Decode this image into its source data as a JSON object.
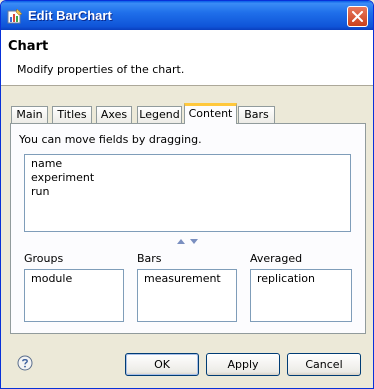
{
  "window": {
    "title": "Edit BarChart"
  },
  "header": {
    "title": "Chart",
    "description": "Modify properties of the chart."
  },
  "tabs": [
    {
      "label": "Main",
      "active": false
    },
    {
      "label": "Titles",
      "active": false
    },
    {
      "label": "Axes",
      "active": false
    },
    {
      "label": "Legend",
      "active": false
    },
    {
      "label": "Content",
      "active": true
    },
    {
      "label": "Bars",
      "active": false
    }
  ],
  "content": {
    "hint": "You can move fields by dragging.",
    "fields": [
      "name",
      "experiment",
      "run"
    ],
    "groups": {
      "label": "Groups",
      "items": [
        "module"
      ]
    },
    "bars": {
      "label": "Bars",
      "items": [
        "measurement"
      ]
    },
    "averaged": {
      "label": "Averaged",
      "items": [
        "replication"
      ]
    }
  },
  "buttons": {
    "ok": "OK",
    "apply": "Apply",
    "cancel": "Cancel"
  },
  "colors": {
    "titlebar": "#0A5FE8",
    "active_tab_accent": "#FFC83C",
    "dialog_bg": "#ECE9D8"
  },
  "icons": {
    "app": "barchart-edit-icon",
    "close": "close-icon",
    "help": "help-icon",
    "move": "move-up-down-arrows-icon"
  }
}
